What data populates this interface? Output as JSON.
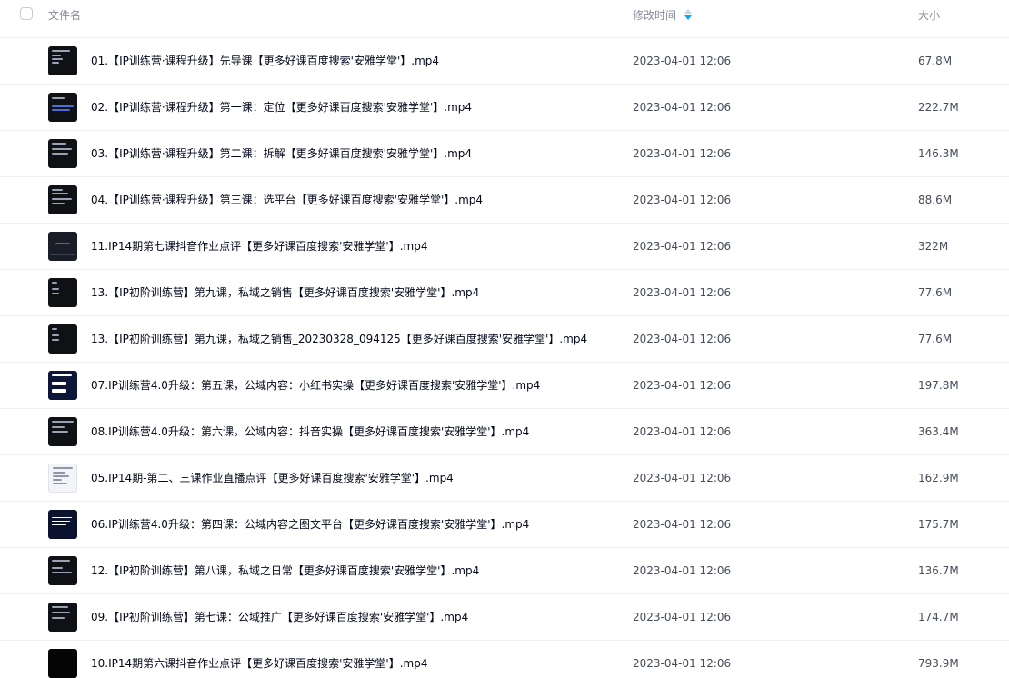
{
  "header": {
    "name_label": "文件名",
    "time_label": "修改时间",
    "size_label": "大小",
    "sort_icon": "sort-descending-icon",
    "accent_color": "#06a7ff"
  },
  "files": [
    {
      "name": "01.【IP训练营·课程升级】先导课【更多好课百度搜索'安雅学堂'】.mp4",
      "modified": "2023-04-01 12:06",
      "size": "67.8M",
      "icon": "video-thumbnail"
    },
    {
      "name": "02.【IP训练营·课程升级】第一课：定位【更多好课百度搜索'安雅学堂'】.mp4",
      "modified": "2023-04-01 12:06",
      "size": "222.7M",
      "icon": "video-thumbnail"
    },
    {
      "name": "03.【IP训练营·课程升级】第二课：拆解【更多好课百度搜索'安雅学堂'】.mp4",
      "modified": "2023-04-01 12:06",
      "size": "146.3M",
      "icon": "video-thumbnail"
    },
    {
      "name": "04.【IP训练营·课程升级】第三课：选平台【更多好课百度搜索'安雅学堂'】.mp4",
      "modified": "2023-04-01 12:06",
      "size": "88.6M",
      "icon": "video-thumbnail"
    },
    {
      "name": "11.IP14期第七课抖音作业点评【更多好课百度搜索'安雅学堂'】.mp4",
      "modified": "2023-04-01 12:06",
      "size": "322M",
      "icon": "video-thumbnail"
    },
    {
      "name": "13.【IP初阶训练营】第九课，私域之销售【更多好课百度搜索'安雅学堂'】.mp4",
      "modified": "2023-04-01 12:06",
      "size": "77.6M",
      "icon": "video-thumbnail"
    },
    {
      "name": "13.【IP初阶训练营】第九课，私域之销售_20230328_094125【更多好课百度搜索'安雅学堂'】.mp4",
      "modified": "2023-04-01 12:06",
      "size": "77.6M",
      "icon": "video-thumbnail"
    },
    {
      "name": "07.IP训练营4.0升级：第五课，公域内容：小红书实操【更多好课百度搜索'安雅学堂'】.mp4",
      "modified": "2023-04-01 12:06",
      "size": "197.8M",
      "icon": "video-thumbnail"
    },
    {
      "name": "08.IP训练营4.0升级：第六课，公域内容：抖音实操【更多好课百度搜索'安雅学堂'】.mp4",
      "modified": "2023-04-01 12:06",
      "size": "363.4M",
      "icon": "video-thumbnail"
    },
    {
      "name": "05.IP14期-第二、三课作业直播点评【更多好课百度搜索'安雅学堂'】.mp4",
      "modified": "2023-04-01 12:06",
      "size": "162.9M",
      "icon": "video-thumbnail"
    },
    {
      "name": "06.IP训练营4.0升级：第四课：公域内容之图文平台【更多好课百度搜索'安雅学堂'】.mp4",
      "modified": "2023-04-01 12:06",
      "size": "175.7M",
      "icon": "video-thumbnail"
    },
    {
      "name": "12.【IP初阶训练营】第八课，私域之日常【更多好课百度搜索'安雅学堂'】.mp4",
      "modified": "2023-04-01 12:06",
      "size": "136.7M",
      "icon": "video-thumbnail"
    },
    {
      "name": "09.【IP初阶训练营】第七课：公域推广【更多好课百度搜索'安雅学堂'】.mp4",
      "modified": "2023-04-01 12:06",
      "size": "174.7M",
      "icon": "video-thumbnail"
    },
    {
      "name": "10.IP14期第六课抖音作业点评【更多好课百度搜索'安雅学堂'】.mp4",
      "modified": "2023-04-01 12:06",
      "size": "793.9M",
      "icon": "video-thumbnail"
    }
  ]
}
